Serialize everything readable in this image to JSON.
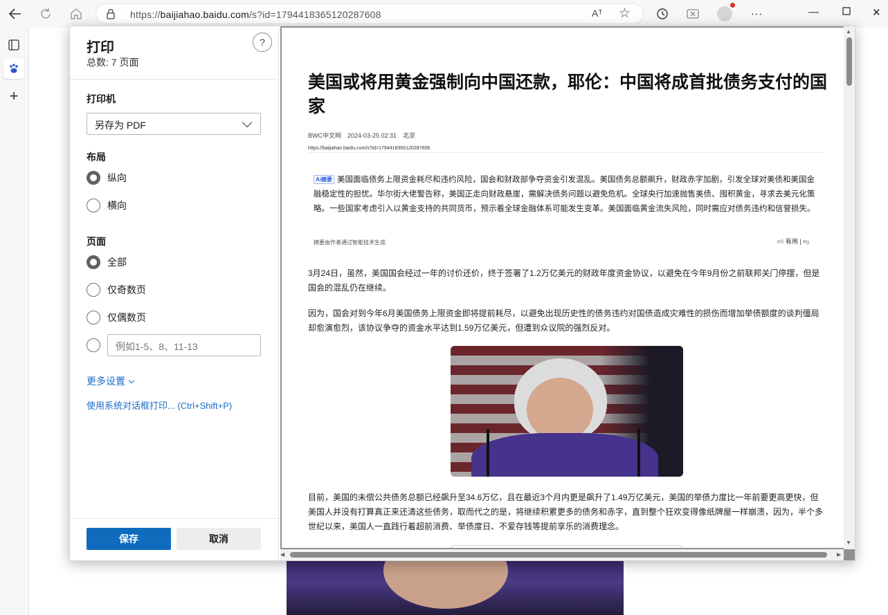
{
  "browser": {
    "url_prefix": "https://",
    "url_domain": "baijiahao.baidu.com",
    "url_path": "/s?id=1794418365120287608",
    "read_aloud": "Aᵀ"
  },
  "print": {
    "title": "打印",
    "total_pages": "总数: 7 页面",
    "help": "?",
    "printer_label": "打印机",
    "printer_value": "另存为 PDF",
    "layout_label": "布局",
    "layout_options": [
      "纵向",
      "横向"
    ],
    "pages_label": "页面",
    "pages_options": [
      "全部",
      "仅奇数页",
      "仅偶数页"
    ],
    "pages_placeholder": "例如1-5、8、11-13",
    "more_settings": "更多设置",
    "system_dialog": "使用系统对话框打印... (Ctrl+Shift+P)",
    "save": "保存",
    "cancel": "取消"
  },
  "article": {
    "title": "美国或将用黄金强制向中国还款，耶伦：中国将成首批债务支付的国家",
    "source": "BWC中文网",
    "date": "2024-03-25 02:31",
    "location": "北京",
    "url": "https://baijiahao.baidu.com/s?id=1794418365120287608",
    "ai_badge": "Ai摘要",
    "ai_summary": "美国面临债务上限资金耗尽和违约风险，国会和财政部争夺资金引发混乱。美国债务总额飙升，财政赤字加剧，引发全球对美债和美国金融稳定性的担忧。华尔街大佬警告称，美国正走向财政悬崖，需解决债务问题以避免危机。全球央行加速抛售美债、囤积黄金，寻求去美元化策略。一些国家考虑引入以黄金支持的共同货币，预示着全球金融体系可能发生变革。美国面临黄金流失风险，同时需应对债务违约和信誉损失。",
    "ai_note": "摘要由作者通过智能技术生成",
    "useful": "有用",
    "paragraphs": [
      "3月24日，虽然，美国国会经过一年的讨价还价，终于签署了1.2万亿美元的财政年度资金协议，以避免在今年9月份之前联邦关门停摆，但是国会的混乱仍在继续。",
      "因为，国会对到今年6月美国债务上限资金即将提前耗尽，以避免出现历史性的债务违约对国债造成灾难性的损伤而增加举债额度的谈判僵局却愈演愈烈，该协议争夺的资金水平达到1.59万亿美元，但遭到众议院的强烈反对。",
      "目前，美国的未偿公共债务总额已经飙升至34.6万亿，且在最近3个月内更是飙升了1.49万亿美元，美国的举债力度比一年前要更高更快，但美国人并没有打算真正来还清这些债务，取而代之的是，将继续积累更多的债务和赤字，直到整个狂欢变得像纸牌屋一样崩溃，因为，半个多世纪以来，美国人一直践行着超前消费、举债度日、不爱存钱等提前享乐的消费理念。"
    ]
  }
}
